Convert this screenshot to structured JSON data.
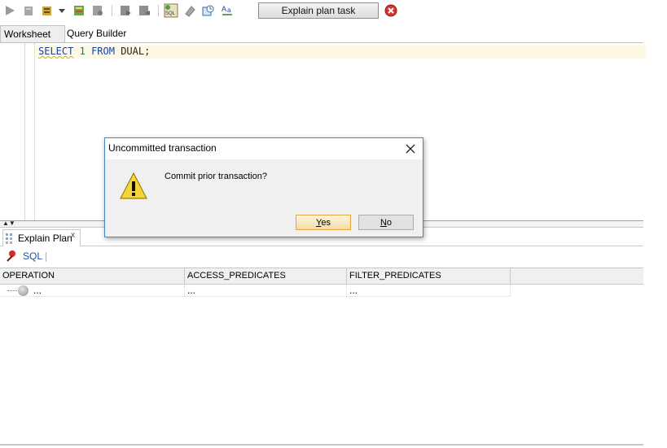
{
  "toolbar": {
    "icons": [
      "run-statement-icon",
      "run-script-icon",
      "autotrace-icon",
      "explain-plan-icon",
      "sql-tuning-icon",
      "commit-icon",
      "rollback-icon",
      "sql-history-icon",
      "eraser-icon",
      "unshared-worksheet-icon",
      "format-icon"
    ],
    "task_label": "Explain plan task"
  },
  "tabs": [
    "Worksheet",
    "Query Builder"
  ],
  "editor": {
    "tokens": {
      "select": "SELECT",
      "one": "1",
      "from": "FROM",
      "table": "DUAL",
      "semicolon": ";"
    }
  },
  "panel": {
    "tab_label": "Explain Plan",
    "tab_close": "x",
    "sql_label": "SQL"
  },
  "grid": {
    "columns": [
      "OPERATION",
      "ACCESS_PREDICATES",
      "FILTER_PREDICATES"
    ],
    "rows": [
      {
        "operation": "...",
        "access": "...",
        "filter": "..."
      }
    ]
  },
  "dialog": {
    "title": "Uncommitted transaction",
    "message": "Commit prior transaction?",
    "yes_label": "Yes",
    "no_label": "No"
  },
  "colors": {
    "keyword": "#1a3fa8",
    "number": "#1a7d7d",
    "dialog_border": "#3c88c9",
    "default_button_border": "#e7a540",
    "cancel_red": "#d9342b",
    "sql_link": "#1b4fa0"
  }
}
